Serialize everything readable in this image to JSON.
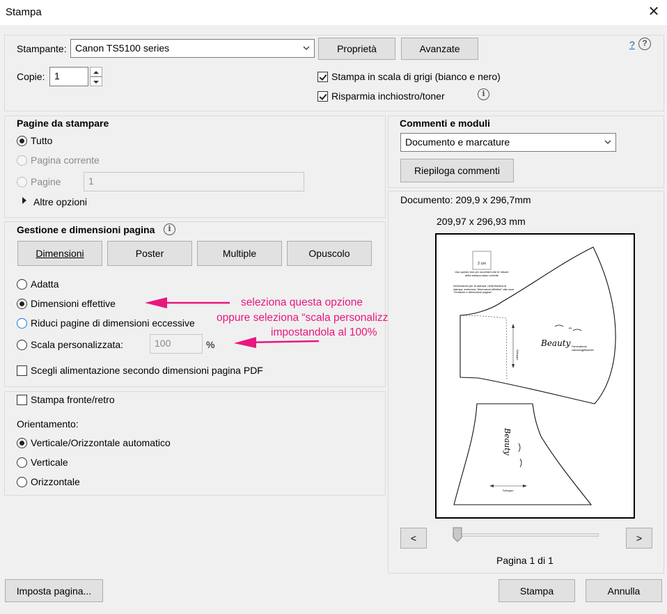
{
  "window": {
    "title": "Stampa",
    "close_symbol": "✕"
  },
  "printer": {
    "label": "Stampante:",
    "selected": "Canon TS5100 series",
    "properties_btn": "Proprietà",
    "advanced_btn": "Avanzate",
    "help_link": "?",
    "copies_label": "Copie:",
    "copies_value": "1",
    "grayscale_label": "Stampa in scala di grigi (bianco e nero)",
    "grayscale_checked": true,
    "save_ink_label": "Risparmia inchiostro/toner",
    "save_ink_checked": true
  },
  "pages": {
    "heading": "Pagine da stampare",
    "all": "Tutto",
    "current": "Pagina corrente",
    "pages": "Pagine",
    "pages_value": "1",
    "more": "Altre opzioni"
  },
  "sizing": {
    "heading": "Gestione e dimensioni pagina",
    "tabs": [
      "Dimensioni",
      "Poster",
      "Multiple",
      "Opuscolo"
    ],
    "fit": "Adatta",
    "actual": "Dimensioni effettive",
    "shrink": "Riduci pagine di dimensioni eccessive",
    "custom": "Scala personalizzata:",
    "custom_value": "100",
    "custom_unit": "%",
    "paper_source": "Scegli alimentazione secondo dimensioni pagina PDF"
  },
  "duplex": {
    "label": "Stampa fronte/retro",
    "orientation_label": "Orientamento:",
    "auto": "Verticale/Orizzontale automatico",
    "portrait": "Verticale",
    "landscape": "Orizzontale"
  },
  "comments": {
    "heading": "Commenti e moduli",
    "selected": "Documento e marcature",
    "summarize_btn": "Riepiloga commenti"
  },
  "preview": {
    "document_size": "Documento: 209,9 x 296,7mm",
    "page_size": "209,97 x 296,93 mm",
    "prev": "<",
    "next": ">",
    "page_indicator": "Pagina 1 di 1",
    "page_progress": 0,
    "doc_texts": {
      "box": "2 cm",
      "note1": "Usa questo box per accertarti che le misure della stampa siano corrette",
      "note2": "Informazioni per la stampa: nella finestra di stampa, seleziona \"dimensioni effettive\" alla voce \"Gestione e dimensioni pagina\".",
      "brand": "Beauty",
      "brand_sub": "Generations",
      "brand_sub2": "unamicaoggettoperato",
      "v_label": "Sviluppo",
      "h_label": "Sviluppo"
    }
  },
  "annotations": {
    "line1": "seleziona questa opzione",
    "line2": "oppure seleziona “scala personalizzata”",
    "line3": "impostandola al 100%",
    "color": "#e8177d"
  },
  "footer": {
    "page_setup": "Imposta pagina...",
    "print": "Stampa",
    "cancel": "Annulla"
  }
}
